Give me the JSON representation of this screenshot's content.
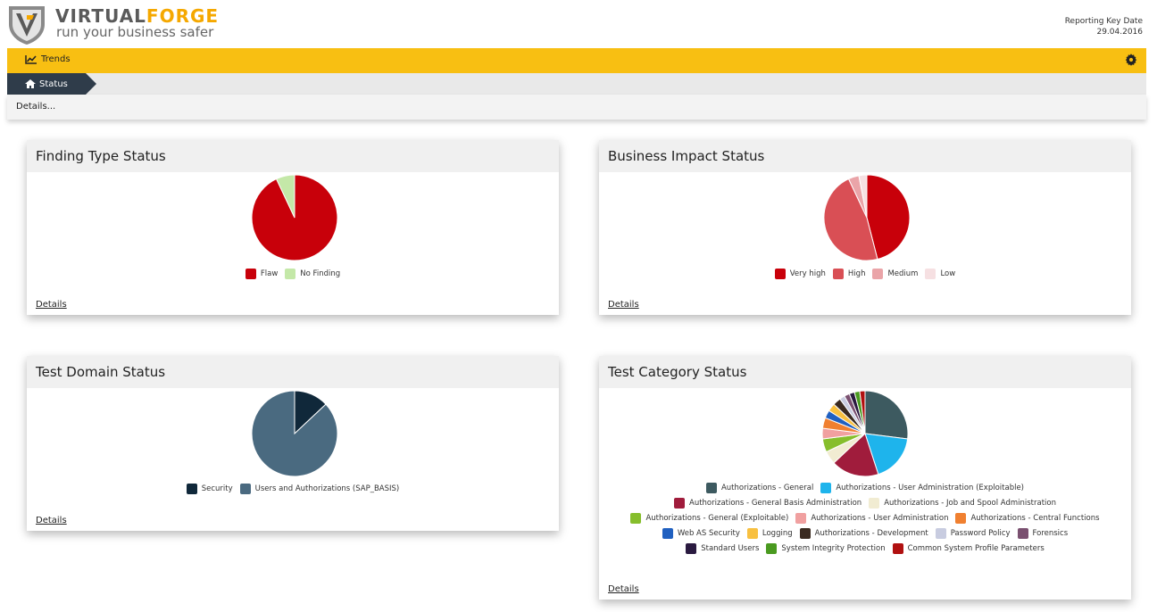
{
  "header": {
    "brand_part1": "VIRTUAL",
    "brand_part2": "FORGE",
    "tagline": "run your business safer",
    "key_date_label": "Reporting Key Date",
    "key_date_value": "29.04.2016"
  },
  "menu": {
    "trends_label": "Trends",
    "trends_icon": "line-chart-icon",
    "settings_icon": "gear-icon",
    "accent_color": "#f8bf12"
  },
  "breadcrumb": {
    "status_label": "Status",
    "status_icon": "home-icon"
  },
  "details_bar": {
    "label": "Details..."
  },
  "panels": {
    "finding_type": {
      "title": "Finding Type Status",
      "details_link": "Details",
      "chart_data": {
        "type": "pie",
        "series": [
          {
            "name": "Flaw",
            "value": 93,
            "color": "#c8000a"
          },
          {
            "name": "No Finding",
            "value": 7,
            "color": "#c4e8a8"
          }
        ]
      }
    },
    "business_impact": {
      "title": "Business Impact Status",
      "details_link": "Details",
      "chart_data": {
        "type": "pie",
        "series": [
          {
            "name": "Very high",
            "value": 46,
            "color": "#c8000a"
          },
          {
            "name": "High",
            "value": 47,
            "color": "#d94f55"
          },
          {
            "name": "Medium",
            "value": 4,
            "color": "#eaa4a8"
          },
          {
            "name": "Low",
            "value": 3,
            "color": "#f6e0e2"
          }
        ]
      }
    },
    "test_domain": {
      "title": "Test Domain Status",
      "details_link": "Details",
      "chart_data": {
        "type": "pie",
        "series": [
          {
            "name": "Security",
            "value": 13,
            "color": "#10283a"
          },
          {
            "name": "Users and Authorizations (SAP_BASIS)",
            "value": 87,
            "color": "#4a6a80"
          }
        ]
      }
    },
    "test_category": {
      "title": "Test Category Status",
      "details_link": "Details",
      "chart_data": {
        "type": "pie",
        "series": [
          {
            "name": "Authorizations - General",
            "value": 27,
            "color": "#3d5a60"
          },
          {
            "name": "Authorizations - User Administration (Exploitable)",
            "value": 18,
            "color": "#1eb4ec"
          },
          {
            "name": "Authorizations - General Basis Administration",
            "value": 18,
            "color": "#a01c3c"
          },
          {
            "name": "Authorizations - Job and Spool Administration",
            "value": 5,
            "color": "#f1ecd2"
          },
          {
            "name": "Authorizations - General (Exploitable)",
            "value": 5,
            "color": "#86be2c"
          },
          {
            "name": "Authorizations - User Administration",
            "value": 4,
            "color": "#f0a0a0"
          },
          {
            "name": "Authorizations - Central Functions",
            "value": 4,
            "color": "#f08030"
          },
          {
            "name": "Web AS Security",
            "value": 3,
            "color": "#2060c0"
          },
          {
            "name": "Logging",
            "value": 3,
            "color": "#f8c040"
          },
          {
            "name": "Authorizations - Development",
            "value": 3,
            "color": "#3a2a20"
          },
          {
            "name": "Password Policy",
            "value": 2,
            "color": "#c8cce0"
          },
          {
            "name": "Forensics",
            "value": 2,
            "color": "#7a5070"
          },
          {
            "name": "Standard Users",
            "value": 2,
            "color": "#2a1a40"
          },
          {
            "name": "System Integrity Protection",
            "value": 2,
            "color": "#4a9a20"
          },
          {
            "name": "Common System Profile Parameters",
            "value": 2,
            "color": "#b01010"
          }
        ],
        "legend_rows": [
          [
            0,
            1
          ],
          [
            2,
            3
          ],
          [
            4,
            5,
            6
          ],
          [
            7,
            8,
            9,
            10,
            11
          ],
          [
            12,
            13,
            14
          ]
        ]
      }
    }
  }
}
